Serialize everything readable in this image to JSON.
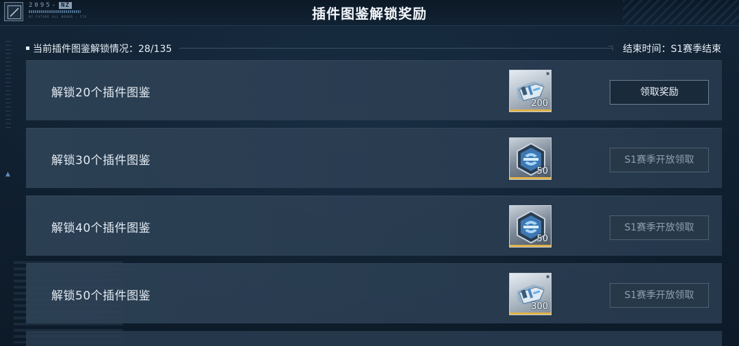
{
  "header": {
    "title": "插件图鉴解锁奖励",
    "brand_code": "2095-",
    "brand_badge": "NZ",
    "brand_sub": "NZ FUTURE ALL NEWER - 576"
  },
  "progress": {
    "label": "当前插件图鉴解锁情况：28/135",
    "end_time": "结束时间：S1赛季结束"
  },
  "rewards": [
    {
      "label": "解锁20个插件图鉴",
      "item_icon": "card-icon",
      "count": "200",
      "button": "领取奖励",
      "state": "claimable"
    },
    {
      "label": "解锁30个插件图鉴",
      "item_icon": "emblem-icon",
      "count": "50",
      "button": "S1赛季开放领取",
      "state": "locked"
    },
    {
      "label": "解锁40个插件图鉴",
      "item_icon": "emblem-icon",
      "count": "50",
      "button": "S1赛季开放领取",
      "state": "locked"
    },
    {
      "label": "解锁50个插件图鉴",
      "item_icon": "card-icon",
      "count": "300",
      "button": "S1赛季开放领取",
      "state": "locked"
    }
  ],
  "colors": {
    "background": "#0f1d2c",
    "row": "#2e4256",
    "item_bar": "#e0b24a",
    "button_border": "#6c8094"
  }
}
